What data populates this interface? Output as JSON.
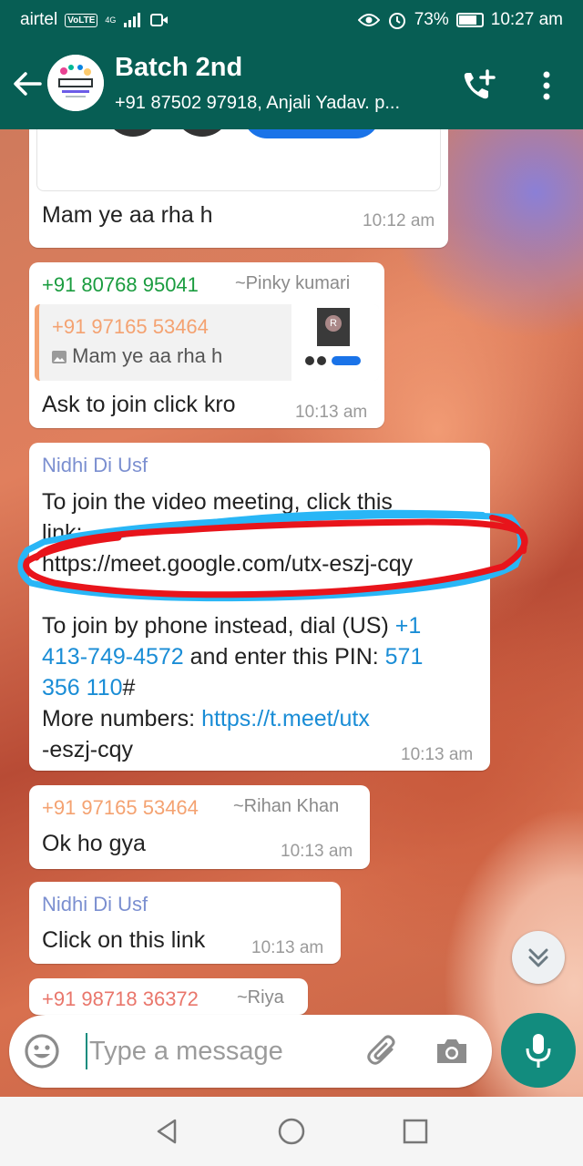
{
  "status_bar": {
    "carrier": "airtel",
    "volte": "VoLTE",
    "network": "4G",
    "battery": "73%",
    "battery_level": 0.73,
    "time": "10:27 am"
  },
  "header": {
    "title": "Batch 2nd",
    "subtitle": "+91 87502 97918, Anjali Yadav. p..."
  },
  "messages": [
    {
      "text": "Mam ye aa rha h",
      "time": "10:12 am"
    },
    {
      "sender_number": "+91 80768 95041",
      "sender_name": "~Pinky kumari",
      "quote_number": "+91 97165 53464",
      "quote_text": "Mam ye aa rha h",
      "thumb_initial": "R",
      "text": "Ask to join click kro",
      "time": "10:13 am"
    },
    {
      "sender": "Nidhi Di Usf",
      "line1": "To join the video meeting, click this",
      "line2": "link:",
      "link": "https://meet.google.com/utx-eszj-cqy",
      "phone_prefix": "To join by phone instead, dial (US) ",
      "phone_a": "+1",
      "phone_b": "413-749-4572",
      "pin_prefix": " and enter this PIN: ",
      "pin_a": "571",
      "pin_b": "356 110",
      "pin_suffix": "#",
      "more_prefix": "More numbers: ",
      "more_link_a": "https://t.meet/utx",
      "more_link_b": "-eszj-cqy",
      "time": "10:13 am"
    },
    {
      "sender_number": "+91 97165 53464",
      "sender_name": "~Rihan Khan",
      "text": "Ok ho gya",
      "time": "10:13 am"
    },
    {
      "sender": "Nidhi Di Usf",
      "text": "Click on this link",
      "time": "10:13 am"
    },
    {
      "sender_number": "+91 98718 36372",
      "sender_name": "~Riya"
    }
  ],
  "composer": {
    "placeholder": "Type a message"
  },
  "colors": {
    "header": "#075e54",
    "accent": "#128c7e",
    "link": "#1a8dd6",
    "sender_green": "#1a9c3f",
    "sender_orange": "#f4a271",
    "sender_purple": "#7b8fd0",
    "annotation_red": "#e8141b",
    "annotation_blue": "#29b6f6"
  },
  "icons": [
    "back-arrow-icon",
    "add-call-icon",
    "more-vert-icon",
    "emoji-icon",
    "attach-icon",
    "camera-icon",
    "mic-icon",
    "scroll-down-icon",
    "nav-back-icon",
    "nav-home-icon",
    "nav-recent-icon"
  ]
}
